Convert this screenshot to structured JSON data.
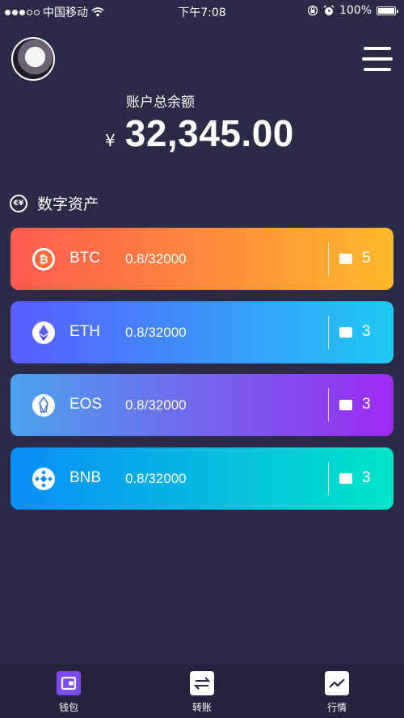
{
  "status_bar": {
    "carrier": "中国移动",
    "time": "下午7:08",
    "battery": "100%",
    "battery_level": 1.0,
    "signal_bars_filled": 3,
    "signal_bars_total": 5
  },
  "header": {
    "avatar_icon": "user-avatar",
    "menu_icon": "hamburger-menu-icon"
  },
  "balance": {
    "label": "账户总余额",
    "currency_symbol": "¥",
    "value": "32,345.00"
  },
  "assets": {
    "title": "数字资产",
    "title_icon": "currency-exchange-icon",
    "items": [
      {
        "symbol": "BTC",
        "amount": "0.8/32000",
        "wallet_count": "5",
        "icon": "bitcoin-icon",
        "colors": [
          "#ff5a4f",
          "#ffb82a"
        ]
      },
      {
        "symbol": "ETH",
        "amount": "0.8/32000",
        "wallet_count": "3",
        "icon": "ethereum-icon",
        "colors": [
          "#5a5cff",
          "#1fc9f4"
        ]
      },
      {
        "symbol": "EOS",
        "amount": "0.8/32000",
        "wallet_count": "3",
        "icon": "eos-icon",
        "colors": [
          "#4aa2ec",
          "#9b2af0"
        ]
      },
      {
        "symbol": "BNB",
        "amount": "0.8/32000",
        "wallet_count": "3",
        "icon": "binance-icon",
        "colors": [
          "#0a8df8",
          "#00e5c9"
        ]
      }
    ]
  },
  "tabbar": {
    "items": [
      {
        "label": "钱包",
        "icon": "wallet-tab-icon",
        "active": true
      },
      {
        "label": "转账",
        "icon": "transfer-tab-icon",
        "active": false
      },
      {
        "label": "行情",
        "icon": "market-chart-tab-icon",
        "active": false
      }
    ]
  },
  "colors": {
    "background": "#2b2a47",
    "tabbar_bg": "#24223c",
    "active_tab": "#7b4cf5"
  }
}
